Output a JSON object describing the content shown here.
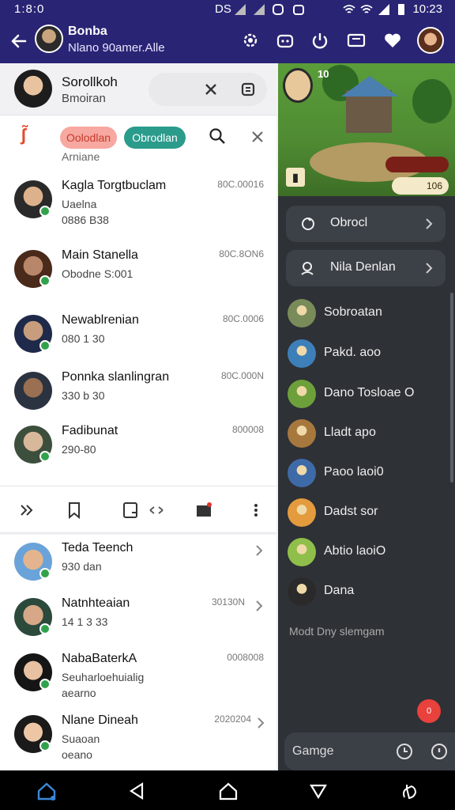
{
  "status_bar": {
    "time": "1:8:0",
    "carrier": "DS",
    "clock": "10:23"
  },
  "app_bar": {
    "title": "Bonba",
    "subtitle": "Nlano 90amer.Alle"
  },
  "top_card": {
    "name": "Sorollkoh",
    "subtitle": "Bmoiran"
  },
  "filters": {
    "chip_red": "Oolodlan",
    "chip_teal": "Obrodlan",
    "sub": "Arniane"
  },
  "chats": [
    {
      "name": "Kagla Torgtbuclam",
      "msg": "Uaelna",
      "msg2": "0886 B38",
      "time": "80C.00016"
    },
    {
      "name": "Main Stanella",
      "msg": "Obodne  S:001",
      "time": "80C.8ON6"
    },
    {
      "name": "Newablrenian",
      "msg": "080 1 30",
      "time": "80C.0006"
    },
    {
      "name": "Ponnka slanlingran",
      "msg": "330 b 30",
      "time": "80C.000N"
    },
    {
      "name": "Fadibunat",
      "msg": "290-80",
      "time": "800008"
    }
  ],
  "lower_chats": [
    {
      "name": "Teda Teench",
      "msg": "930 dan",
      "time": ""
    },
    {
      "name": "Natnhteaian",
      "msg": "14 1 3 33",
      "time": "30130N"
    },
    {
      "name": "NabaBaterkA",
      "msg": "Seuharloehuialig",
      "msg2": "aearno",
      "time": "0008008"
    },
    {
      "name": "Nlane Dineah",
      "msg": "Suaoan",
      "msg2": "oeano",
      "time": "2020204"
    }
  ],
  "game": {
    "level": "10",
    "coins": "106",
    "resource": ""
  },
  "right_panels": [
    {
      "label": "Obrocl"
    },
    {
      "label": "Nila Denlan"
    }
  ],
  "right_list": [
    {
      "label": "Sobroatan",
      "color": "#7a8b5a"
    },
    {
      "label": "Pakd. aoo",
      "color": "#3d7fb9"
    },
    {
      "label": "Dano Tosloae O",
      "color": "#6da03a"
    },
    {
      "label": "Lladt apo",
      "color": "#a7783e"
    },
    {
      "label": "Paoo laoi0",
      "color": "#3f6aa8"
    },
    {
      "label": "Dadst sor",
      "color": "#e39b3e"
    },
    {
      "label": "Abtio laoiO",
      "color": "#8fbf4a"
    },
    {
      "label": "Dana",
      "color": "#2a2a2a"
    }
  ],
  "right_footer": "Modt Dny slemgam",
  "fab_label": "0",
  "input": {
    "value": "Gamge"
  },
  "icons": {
    "back": "arrow-left-icon",
    "settings": "gear-icon",
    "bot": "bot-icon",
    "power": "power-icon",
    "screen": "screen-icon",
    "heart": "heart-icon",
    "search": "search-icon",
    "close": "close-icon",
    "home": "home-icon",
    "nav_back": "back-triangle-icon",
    "nav_down": "triangle-down-icon"
  }
}
